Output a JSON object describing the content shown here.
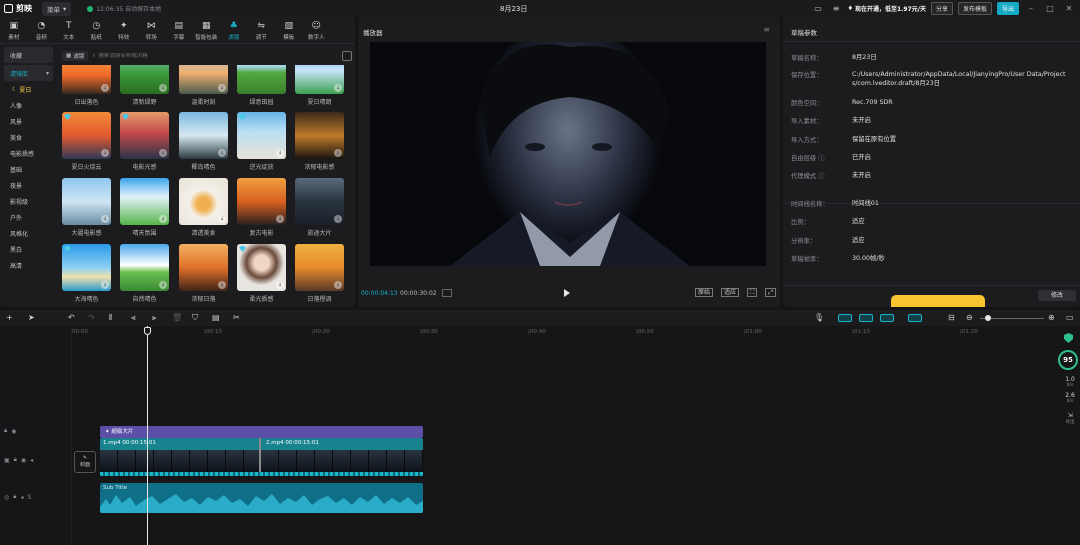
{
  "app": {
    "name": "剪映",
    "menu_label": "菜单",
    "autosave_text": "12:06:35 自动保存本地",
    "project_title": "8月23日",
    "member_text": "现在开通，低至1.97元/天",
    "share_label": "分享",
    "publish_label": "发布模板",
    "export_label": "导出"
  },
  "tools": [
    {
      "label": "素材",
      "icon": "media-icon"
    },
    {
      "label": "音频",
      "icon": "audio-icon"
    },
    {
      "label": "文本",
      "icon": "text-icon"
    },
    {
      "label": "贴纸",
      "icon": "sticker-icon"
    },
    {
      "label": "特效",
      "icon": "effects-icon"
    },
    {
      "label": "转场",
      "icon": "transition-icon"
    },
    {
      "label": "字幕",
      "icon": "subtitle-icon"
    },
    {
      "label": "智能包装",
      "icon": "smart-pack-icon"
    },
    {
      "label": "滤镜",
      "icon": "filter-icon"
    },
    {
      "label": "调节",
      "icon": "adjust-icon"
    },
    {
      "label": "模板",
      "icon": "template-icon"
    },
    {
      "label": "数字人",
      "icon": "digital-human-icon"
    }
  ],
  "left_nav": {
    "collect": "收藏",
    "library": "滤镜库",
    "items": [
      "夏日",
      "人像",
      "风景",
      "美食",
      "电影质感",
      "基础",
      "夜景",
      "影视级",
      "户外",
      "风格化",
      "黑白",
      "高清"
    ]
  },
  "search": {
    "lib_label": "滤镜",
    "placeholder": "搜索滤镜名称或风格"
  },
  "filters": [
    {
      "label": "日出落色"
    },
    {
      "label": "清新绿野"
    },
    {
      "label": "温柔时刻"
    },
    {
      "label": "绿意田园"
    },
    {
      "label": "夏日晴朗"
    },
    {
      "label": "夏日火烧云"
    },
    {
      "label": "电影光感"
    },
    {
      "label": "椰岛晴色"
    },
    {
      "label": "逆光绽放"
    },
    {
      "label": "浓郁电影感"
    },
    {
      "label": "大疆电影感"
    },
    {
      "label": "晴天氛围"
    },
    {
      "label": "清透美食"
    },
    {
      "label": "复古电影"
    },
    {
      "label": "旅途大片"
    },
    {
      "label": "大海晴色"
    },
    {
      "label": "自然晴色"
    },
    {
      "label": "浓郁日落"
    },
    {
      "label": "柔光质感"
    },
    {
      "label": "日落橙调"
    }
  ],
  "player": {
    "title": "播放器",
    "current_time": "00:00:04:13",
    "total_time": "00:00:30:02",
    "ratio_label": "原始",
    "fit_label": "适应"
  },
  "details": {
    "title": "草稿参数",
    "rows": [
      {
        "k": "草稿名称：",
        "v": "8月23日"
      },
      {
        "k": "保存位置：",
        "v": "C:/Users/Administrator/AppData/Local/JianyingPro/User Data/Projects/com.lveditor.draft/8月23日"
      },
      {
        "k": "颜色空间：",
        "v": "Rec.709 SDR"
      },
      {
        "k": "导入素材：",
        "v": "未开启"
      },
      {
        "k": "导入方式：",
        "v": "保留在原有位置"
      },
      {
        "k": "自由层级 ⓘ",
        "v": "已开启"
      },
      {
        "k": "代理模式 ⓘ",
        "v": "未开启"
      },
      {
        "k": "时间线名称：",
        "v": "时间线01"
      },
      {
        "k": "比例：",
        "v": "适应"
      },
      {
        "k": "分辨率：",
        "v": "适应"
      },
      {
        "k": "草稿帧率：",
        "v": "30.00帧/秒"
      }
    ],
    "modify_label": "修改"
  },
  "timeline": {
    "ticks": [
      "00:00",
      "|00:10",
      "|00:20",
      "|00:30",
      "|00:40",
      "|00:50",
      "|01:00",
      "|01:10",
      "|01:20"
    ],
    "fx_clip": "超级大片",
    "clip1": "1.mp4  00:00:15:01",
    "clip2": "2.mp4  00:00:15:01",
    "audio_clip": "Sub Title",
    "cover_label": "封面",
    "score": "95",
    "stat1": "1.0",
    "stat1_unit": "K/s",
    "stat2": "2.6",
    "stat2_unit": "K/s",
    "side_label": "导出"
  }
}
